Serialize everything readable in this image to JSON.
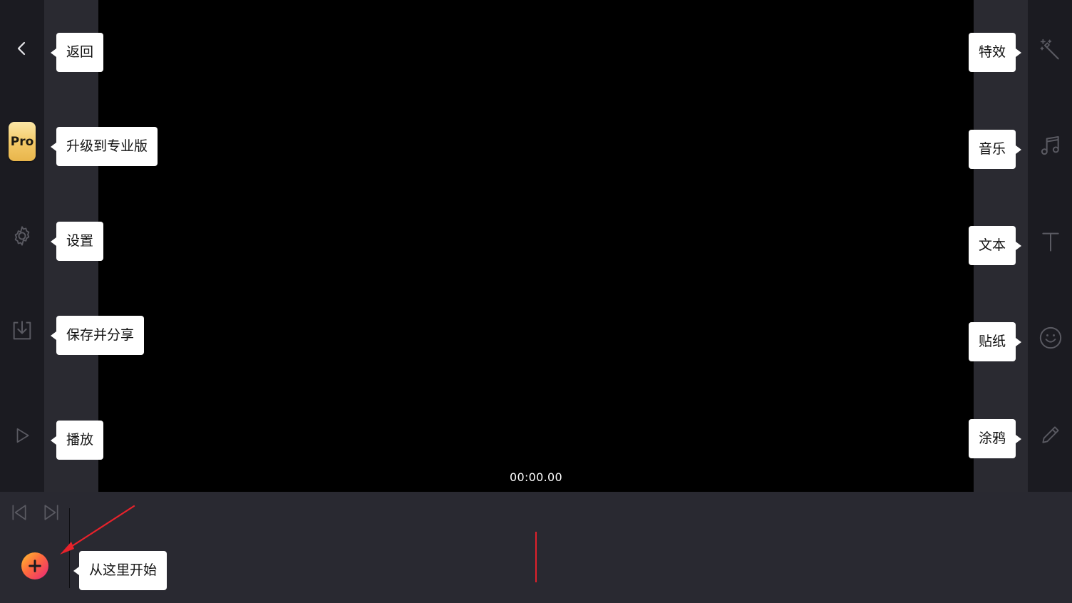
{
  "left_toolbar": {
    "back": {
      "icon": "chevron-left-icon",
      "tip": "返回"
    },
    "pro": {
      "badge_label": "Pro",
      "tip": "升级到专业版"
    },
    "settings": {
      "icon": "gear-icon",
      "tip": "设置"
    },
    "save": {
      "icon": "download-icon",
      "tip": "保存并分享"
    },
    "play": {
      "icon": "play-icon",
      "tip": "播放"
    }
  },
  "right_toolbar": {
    "effects": {
      "icon": "magic-wand-icon",
      "tip": "特效"
    },
    "music": {
      "icon": "music-note-icon",
      "tip": "音乐"
    },
    "text": {
      "icon": "text-t-icon",
      "tip": "文本"
    },
    "sticker": {
      "icon": "smiley-icon",
      "tip": "贴纸"
    },
    "doodle": {
      "icon": "pencil-icon",
      "tip": "涂鸦"
    }
  },
  "preview": {
    "timecode": "00:00.00"
  },
  "timeline": {
    "skip_to_start_icon": "skip-start-icon",
    "skip_to_end_icon": "skip-end-icon",
    "add_icon": "plus-icon",
    "start_tip": "从这里开始"
  },
  "colors": {
    "rail": "#1b1b21",
    "pad": "#2a2a31",
    "timeline": "#292931",
    "pro_gold": "#f3c865",
    "marker_red": "#e0202b",
    "icon_gray": "#5a5a62"
  }
}
